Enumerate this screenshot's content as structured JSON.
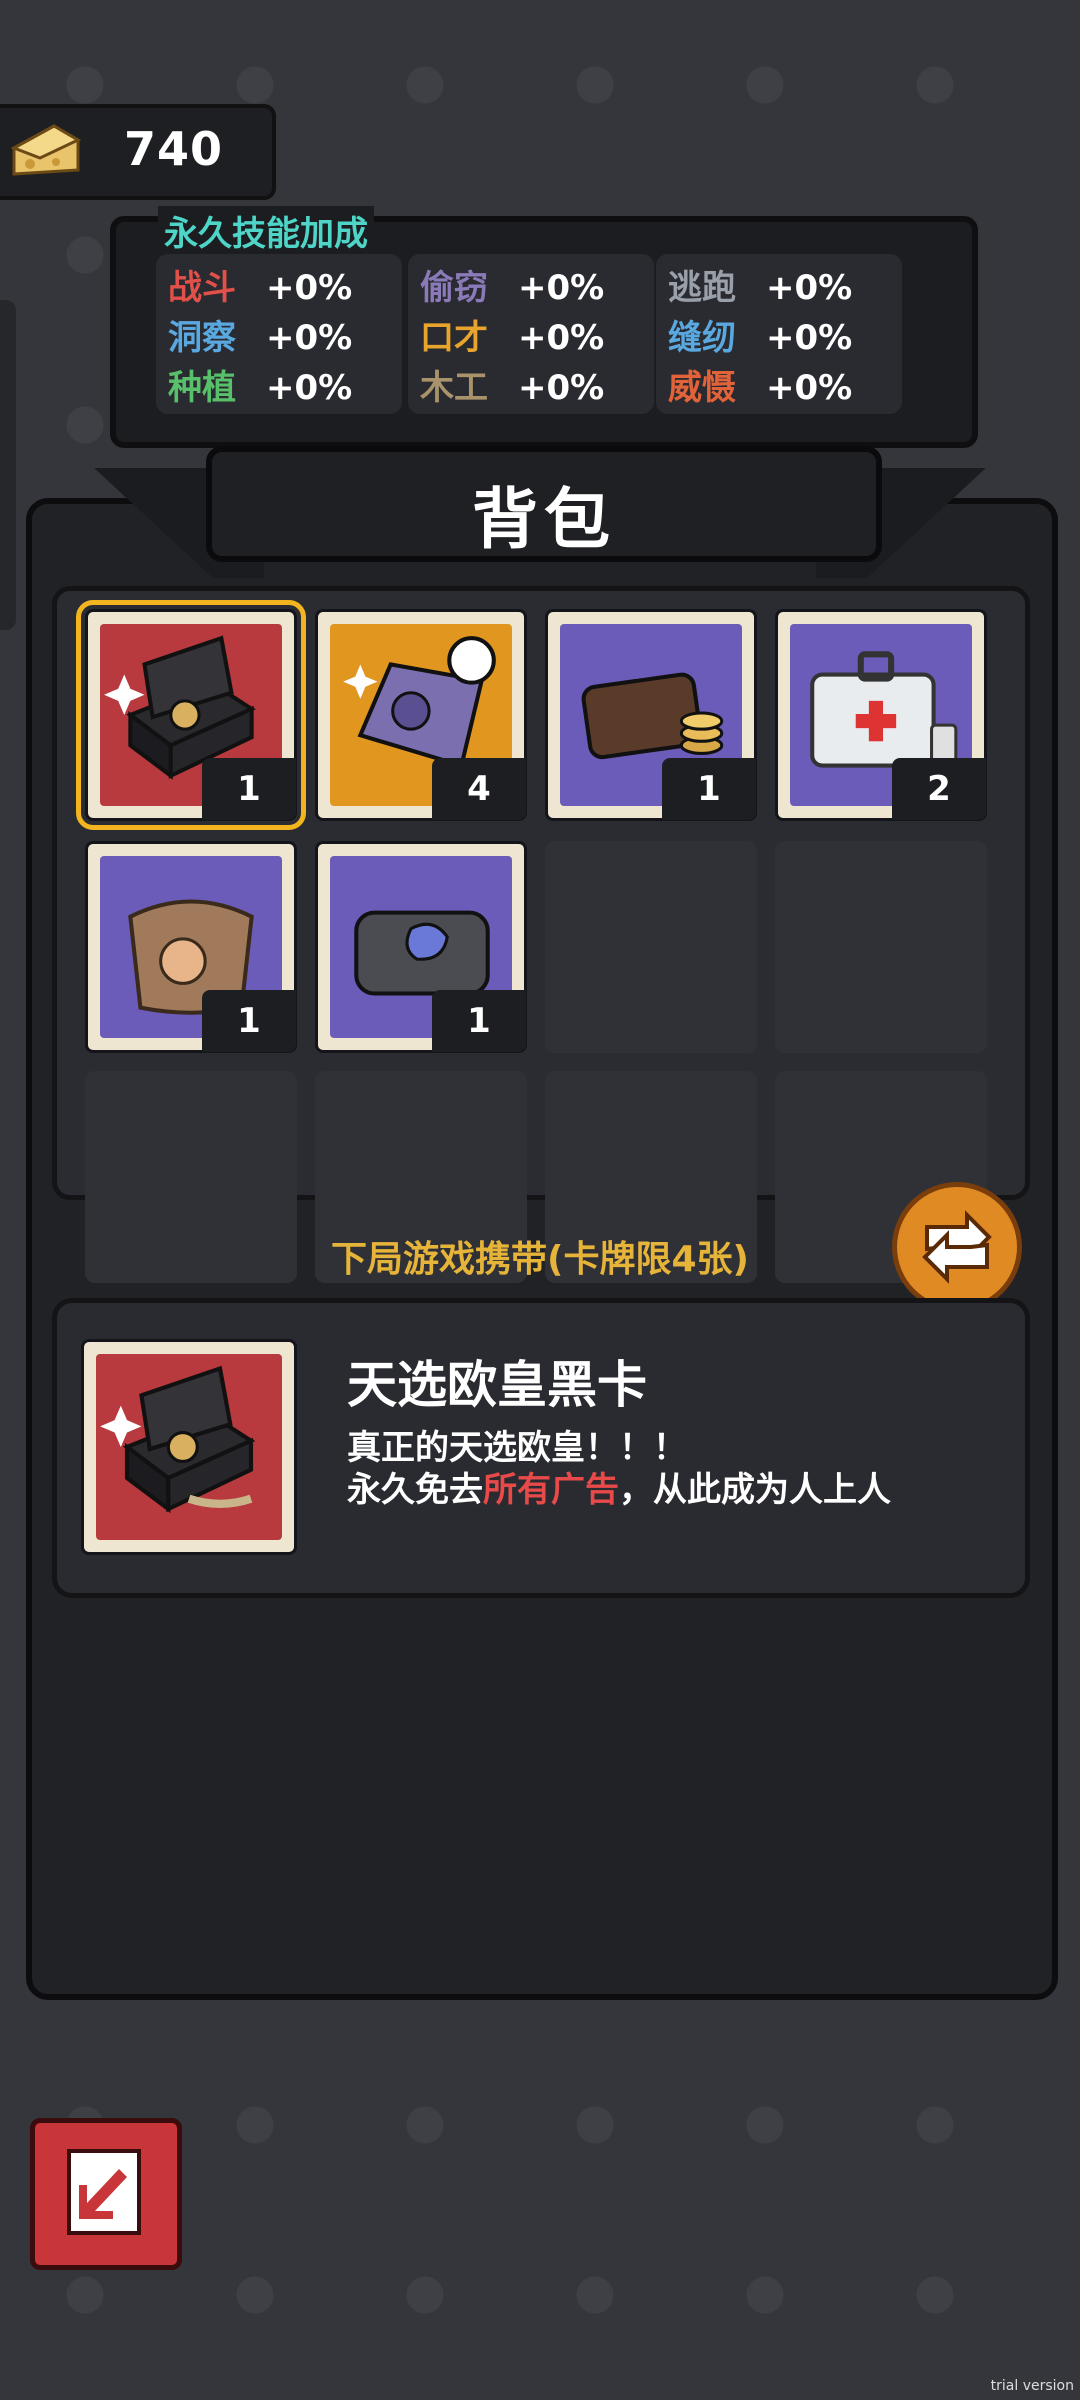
{
  "currency": {
    "icon": "cheese-icon",
    "value": "740"
  },
  "skills": {
    "title": "永久技能加成",
    "columns": [
      [
        {
          "name": "战斗",
          "value": "+0%",
          "color": "#e2504a"
        },
        {
          "name": "洞察",
          "value": "+0%",
          "color": "#5aa8e0"
        },
        {
          "name": "种植",
          "value": "+0%",
          "color": "#58c06a"
        }
      ],
      [
        {
          "name": "偷窃",
          "value": "+0%",
          "color": "#8a7ab8"
        },
        {
          "name": "口才",
          "value": "+0%",
          "color": "#e8a42c"
        },
        {
          "name": "木工",
          "value": "+0%",
          "color": "#a8936a"
        }
      ],
      [
        {
          "name": "逃跑",
          "value": "+0%",
          "color": "#9aa0aa"
        },
        {
          "name": "缝纫",
          "value": "+0%",
          "color": "#5aa8e0"
        },
        {
          "name": "威慑",
          "value": "+0%",
          "color": "#e2633a"
        }
      ]
    ]
  },
  "backpack": {
    "title": "背包"
  },
  "inventory": [
    {
      "name": "lucky-black-card",
      "icon": "gift-box-icon",
      "count": "1",
      "bg": "#b83a3e",
      "selected": true
    },
    {
      "name": "puzzle-card",
      "icon": "puzzle-card-icon",
      "count": "4",
      "bg": "#e0961f",
      "selected": false
    },
    {
      "name": "wallet",
      "icon": "wallet-icon",
      "count": "1",
      "bg": "#6a5cb8",
      "selected": false
    },
    {
      "name": "first-aid-kit",
      "icon": "first-aid-kit-icon",
      "count": "2",
      "bg": "#6a5cb8",
      "selected": false
    },
    {
      "name": "cheese-sack",
      "icon": "sack-icon",
      "count": "1",
      "bg": "#6a5cb8",
      "selected": false
    },
    {
      "name": "pouch",
      "icon": "pouch-icon",
      "count": "1",
      "bg": "#6a5cb8",
      "selected": false
    }
  ],
  "carry_label": "下局游戏携带(卡牌限4张)",
  "detail": {
    "name": "天选欧皇黑卡",
    "line1": "真正的天选欧皇！！！",
    "line2_pre": "永久免去",
    "line2_hl": "所有广告",
    "line2_post": "，从此成为人上人"
  },
  "exit_icon": "exit-door-icon",
  "watermark": "trial version"
}
